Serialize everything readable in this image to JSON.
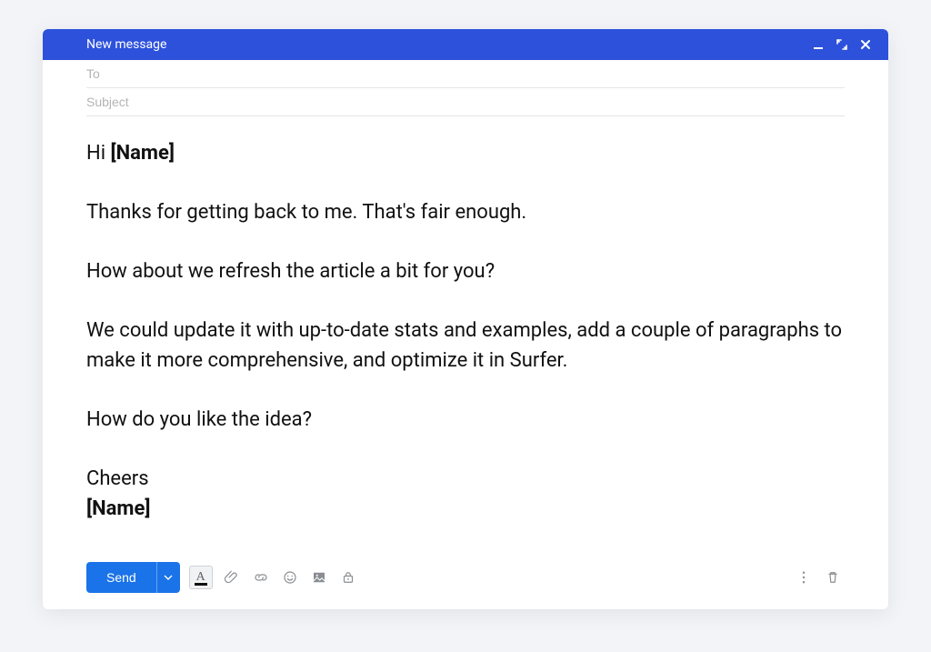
{
  "header": {
    "title": "New message"
  },
  "fields": {
    "to_placeholder": "To",
    "to_value": "",
    "subject_placeholder": "Subject",
    "subject_value": ""
  },
  "body": {
    "greeting_prefix": "Hi ",
    "greeting_name": "[Name]",
    "p1": "Thanks for getting back to me. That's fair enough.",
    "p2": "How about we refresh the article a bit for you?",
    "p3": "We could update it with up-to-date stats and examples, add a couple of paragraphs to make it more comprehensive, and optimize it in Surfer.",
    "p4": "How do you like the idea?",
    "signoff": "Cheers",
    "sig_name": "[Name]"
  },
  "toolbar": {
    "send_label": "Send"
  },
  "colors": {
    "header_bg": "#2d51db",
    "send_bg": "#1a73e8"
  }
}
